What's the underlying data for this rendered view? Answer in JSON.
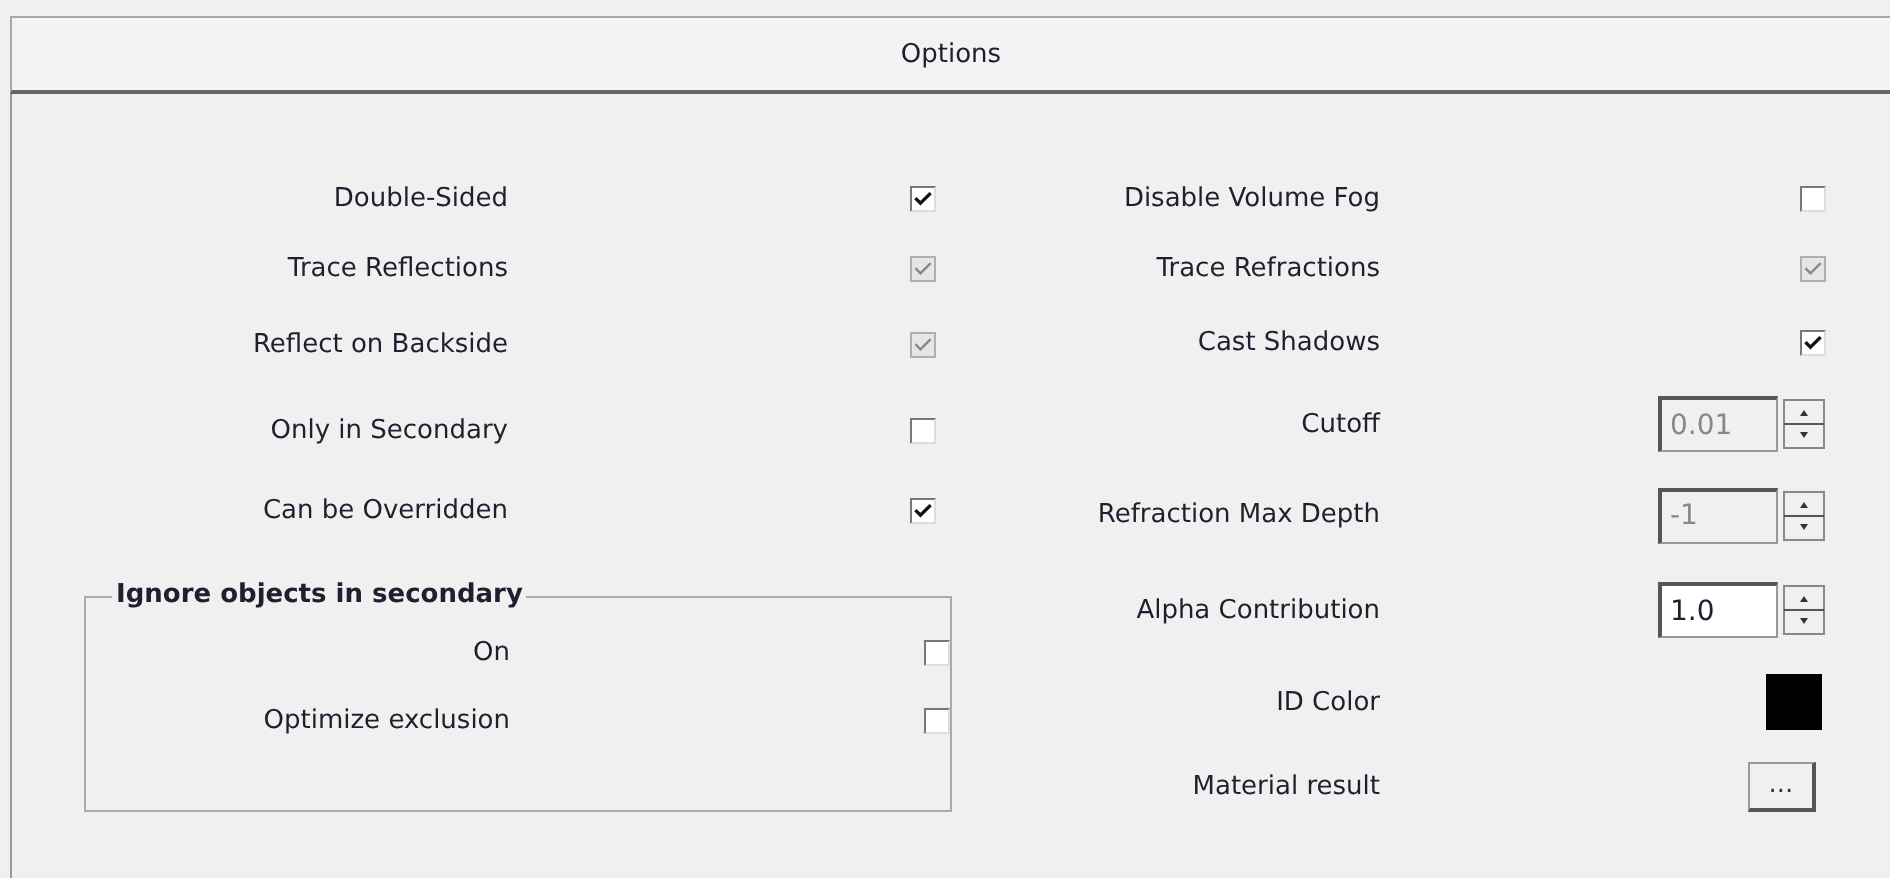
{
  "header": {
    "title": "Options"
  },
  "left_options": [
    {
      "kind": "checkbox",
      "label": "Double-Sided",
      "checked": true,
      "disabled": false
    },
    {
      "kind": "checkbox",
      "label": "Trace Reflections",
      "checked": true,
      "disabled": true
    },
    {
      "kind": "checkbox",
      "label": "Reflect on Backside",
      "checked": true,
      "disabled": true
    },
    {
      "kind": "checkbox",
      "label": "Only in Secondary",
      "checked": false,
      "disabled": false
    },
    {
      "kind": "checkbox",
      "label": "Can be Overridden",
      "checked": true,
      "disabled": false
    }
  ],
  "group": {
    "title": "Ignore objects in secondary",
    "options": [
      {
        "kind": "checkbox",
        "label": "On",
        "checked": false,
        "disabled": false
      },
      {
        "kind": "checkbox",
        "label": "Optimize exclusion",
        "checked": false,
        "disabled": false
      }
    ]
  },
  "right_options": [
    {
      "kind": "checkbox",
      "label": "Disable Volume Fog",
      "checked": false,
      "disabled": false
    },
    {
      "kind": "checkbox",
      "label": "Trace Refractions",
      "checked": true,
      "disabled": true
    },
    {
      "kind": "checkbox",
      "label": "Cast Shadows",
      "checked": true,
      "disabled": false
    },
    {
      "kind": "spinner",
      "label": "Cutoff",
      "value": "0.01",
      "disabled": true
    },
    {
      "kind": "spinner",
      "label": "Refraction Max Depth",
      "value": "-1",
      "disabled": true
    },
    {
      "kind": "spinner",
      "label": "Alpha Contribution",
      "value": "1.0",
      "disabled": false
    },
    {
      "kind": "color",
      "label": "ID Color",
      "color": "#000000"
    },
    {
      "kind": "button",
      "label": "Material result",
      "button": "..."
    }
  ]
}
